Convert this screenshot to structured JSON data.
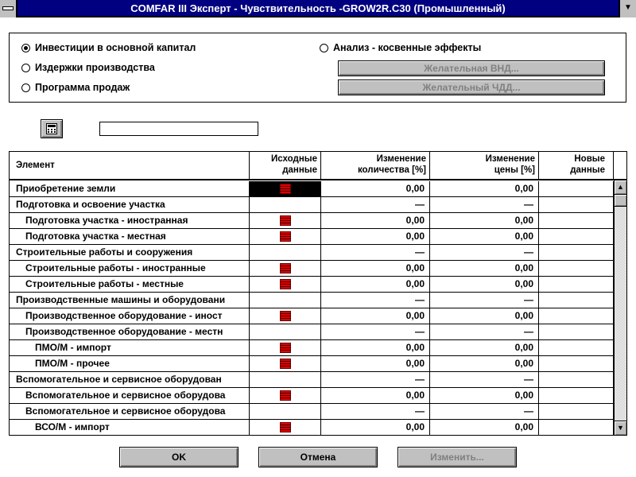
{
  "window": {
    "title": "COMFAR III Эксперт - Чувствительность -GROW2R.C30 (Промышленный)"
  },
  "options": {
    "radios": [
      {
        "label": "Инвестиции в основной капитал",
        "selected": true
      },
      {
        "label": "Издержки производства",
        "selected": false
      },
      {
        "label": "Программа продаж",
        "selected": false
      },
      {
        "label": "Анализ - косвенные эффекты",
        "selected": false
      }
    ],
    "irr_button": "Желательная ВНД...",
    "npv_button": "Желательный ЧДД..."
  },
  "search": {
    "value": ""
  },
  "table": {
    "headers": {
      "element": "Элемент",
      "source_1": "Исходные",
      "source_2": "данные",
      "qty_1": "Изменение",
      "qty_2": "количества [%]",
      "price_1": "Изменение",
      "price_2": "цены [%]",
      "new_1": "Новые",
      "new_2": "данные"
    },
    "rows": [
      {
        "name": "Приобретение земли",
        "level": 0,
        "icon": true,
        "qty": "0,00",
        "price": "0,00",
        "selected": true
      },
      {
        "name": "Подготовка и освоение участка",
        "level": 0,
        "icon": false,
        "qty": "—",
        "price": "—"
      },
      {
        "name": "Подготовка участка - иностранная",
        "level": 1,
        "icon": true,
        "qty": "0,00",
        "price": "0,00"
      },
      {
        "name": "Подготовка участка - местная",
        "level": 1,
        "icon": true,
        "qty": "0,00",
        "price": "0,00"
      },
      {
        "name": "Строительные работы и сооружения",
        "level": 0,
        "icon": false,
        "qty": "—",
        "price": "—"
      },
      {
        "name": "Строительные работы - иностранные",
        "level": 1,
        "icon": true,
        "qty": "0,00",
        "price": "0,00"
      },
      {
        "name": "Строительные работы - местные",
        "level": 1,
        "icon": true,
        "qty": "0,00",
        "price": "0,00"
      },
      {
        "name": "Производственные машины и оборудовани",
        "level": 0,
        "icon": false,
        "qty": "—",
        "price": "—"
      },
      {
        "name": "Производственное оборудование - иност",
        "level": 1,
        "icon": true,
        "qty": "0,00",
        "price": "0,00"
      },
      {
        "name": "Производственное оборудование - местн",
        "level": 1,
        "icon": false,
        "qty": "—",
        "price": "—"
      },
      {
        "name": "ПМО/М - импорт",
        "level": 2,
        "icon": true,
        "qty": "0,00",
        "price": "0,00"
      },
      {
        "name": "ПМО/М - прочее",
        "level": 2,
        "icon": true,
        "qty": "0,00",
        "price": "0,00"
      },
      {
        "name": "Вспомогательное и сервисное оборудован",
        "level": 0,
        "icon": false,
        "qty": "—",
        "price": "—"
      },
      {
        "name": "Вспомогательное и сервисное оборудова",
        "level": 1,
        "icon": true,
        "qty": "0,00",
        "price": "0,00"
      },
      {
        "name": "Вспомогательное и сервисное оборудова",
        "level": 1,
        "icon": false,
        "qty": "—",
        "price": "—"
      },
      {
        "name": "ВСО/М - импорт",
        "level": 2,
        "icon": true,
        "qty": "0,00",
        "price": "0,00"
      }
    ]
  },
  "buttons": {
    "ok": "OK",
    "cancel": "Отмена",
    "change": "Изменить..."
  }
}
